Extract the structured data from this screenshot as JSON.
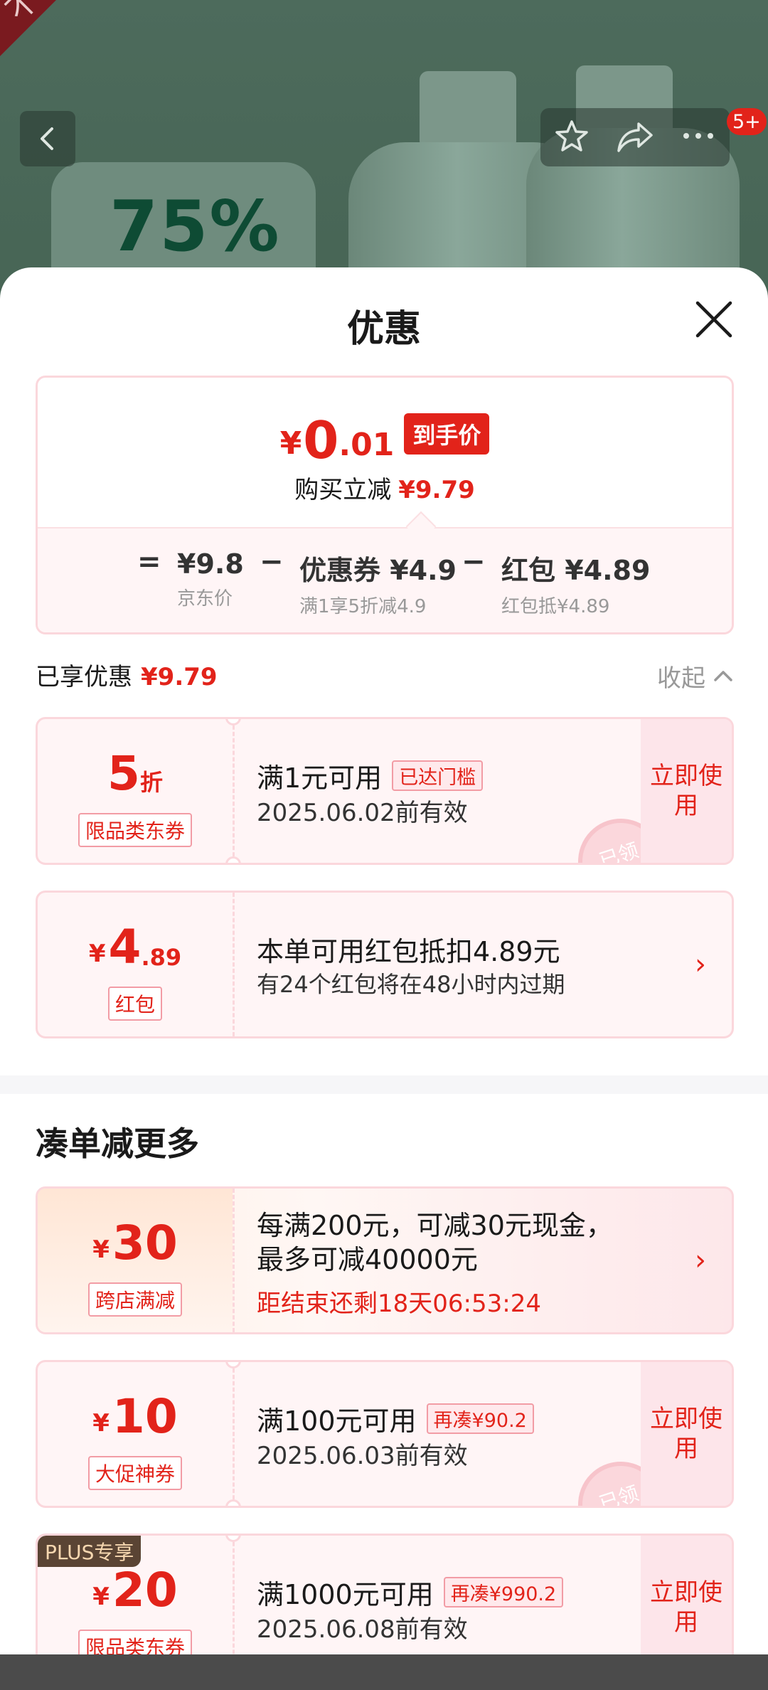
{
  "hero": {
    "ribbon_text": "不满意包退",
    "label_percent": "75%",
    "cart_badge": "5+"
  },
  "sheet": {
    "title": "优惠"
  },
  "summary": {
    "price_symbol": "¥",
    "price_integer": "0",
    "price_decimal": ".01",
    "price_tag": "到手价",
    "save_label": "购买立减",
    "save_amount": "¥9.79",
    "calc": {
      "eq": "=",
      "op1": "−",
      "op2": "−",
      "item1_value": "¥9.8",
      "item1_sub": "京东价",
      "item2_value": "优惠券 ¥4.9",
      "item2_sub": "满1享5折减4.9",
      "item3_value": "红包 ¥4.89",
      "item3_sub": "红包抵¥4.89"
    }
  },
  "enjoyed": {
    "label": "已享优惠",
    "amount": "¥9.79",
    "collapse_label": "收起"
  },
  "coupons": [
    {
      "amount_big": "5",
      "amount_small": "折",
      "type_label": "限品类东券",
      "main": "满1元可用",
      "tag": "已达门槛",
      "sub": "2025.06.02前有效",
      "action": "立即使用",
      "stamp": "已领"
    },
    {
      "yen": "¥",
      "amount_big": "4",
      "amount_small": ".89",
      "type_label": "红包",
      "main": "本单可用红包抵扣4.89元",
      "sub": "有24个红包将在48小时内过期",
      "arrow": "›"
    }
  ],
  "more": {
    "title": "凑单减更多",
    "items": [
      {
        "yen": "¥",
        "amount_big": "30",
        "type_label": "跨店满减",
        "main_line1": "每满200元，可减30元现金，",
        "main_line2": "最多可减40000元",
        "countdown": "距结束还剩18天06:53:24",
        "arrow": "›"
      },
      {
        "yen": "¥",
        "amount_big": "10",
        "type_label": "大促神券",
        "main": "满100元可用",
        "tag": "再凑¥90.2",
        "sub": "2025.06.03前有效",
        "action": "立即使用",
        "stamp": "已领"
      },
      {
        "plus_tag": "PLUS专享",
        "yen": "¥",
        "amount_big": "20",
        "type_label": "限品类东券",
        "main": "满1000元可用",
        "tag": "再凑¥990.2",
        "sub": "2025.06.08前有效",
        "action": "立即使用"
      }
    ]
  },
  "colors": {
    "accent": "#e2231a",
    "coupon_border": "#fbd7dc",
    "coupon_bg": "#fff5f6"
  }
}
